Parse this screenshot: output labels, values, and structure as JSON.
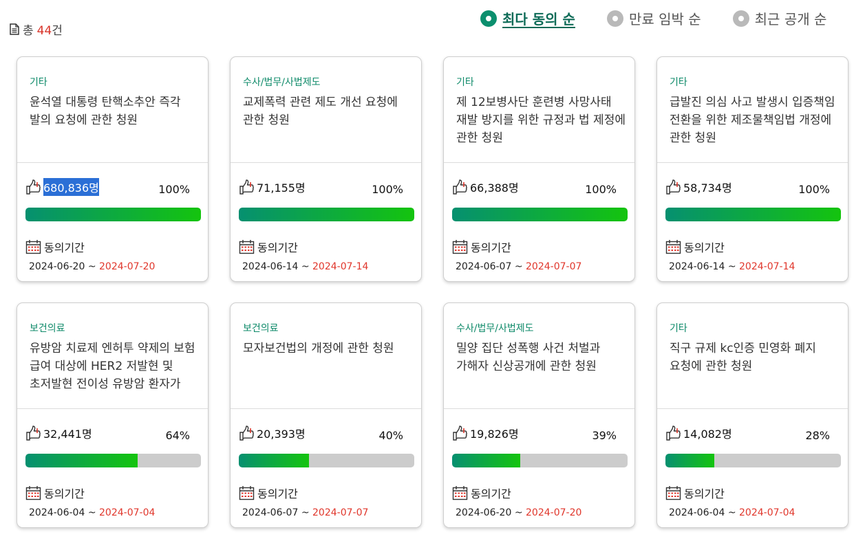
{
  "header": {
    "total_prefix": "총",
    "total_count": "44",
    "total_suffix": "건"
  },
  "sort": {
    "options": [
      {
        "label": "최다 동의 순",
        "selected": true
      },
      {
        "label": "만료 임박 순",
        "selected": false
      },
      {
        "label": "최근 공개 순",
        "selected": false
      }
    ]
  },
  "period_label": "동의기간",
  "date_separator": "~",
  "colors": {
    "accent": "#0c8f6e",
    "bar_start": "#069070",
    "bar_end": "#14c40e",
    "end_date": "#e0362b"
  },
  "icons": {
    "total": "document-icon",
    "likes": "thumbs-up-icon",
    "period": "calendar-icon"
  },
  "petitions": [
    {
      "category": "기타",
      "title": "윤석열 대통령 탄핵소추안 즉각 발의 요청에 관한 청원",
      "likes": "680,836명",
      "percent": "100%",
      "progress": 1.0,
      "start": "2024-06-20",
      "end": "2024-07-20",
      "likes_selected": true
    },
    {
      "category": "수사/법무/사법제도",
      "title": "교제폭력 관련 제도 개선 요청에 관한 청원",
      "likes": "71,155명",
      "percent": "100%",
      "progress": 1.0,
      "start": "2024-06-14",
      "end": "2024-07-14"
    },
    {
      "category": "기타",
      "title": "제 12보병사단 훈련병 사망사태 재발 방지를 위한 규정과 법 제정에 관한 청원",
      "likes": "66,388명",
      "percent": "100%",
      "progress": 1.0,
      "start": "2024-06-07",
      "end": "2024-07-07"
    },
    {
      "category": "기타",
      "title": "급발진 의심 사고 발생시 입증책임 전환을 위한 제조물책임법 개정에 관한 청원",
      "likes": "58,734명",
      "percent": "100%",
      "progress": 1.0,
      "start": "2024-06-14",
      "end": "2024-07-14"
    },
    {
      "category": "보건의료",
      "title": "유방암 치료제 엔허투 약제의 보험 급여 대상에 HER2 저발현 및 초저발현 전이성 유방암 환자가 포함될 수 있도록 요청에 관한 청원",
      "likes": "32,441명",
      "percent": "64%",
      "progress": 0.64,
      "start": "2024-06-04",
      "end": "2024-07-04"
    },
    {
      "category": "보건의료",
      "title": "모자보건법의 개정에 관한 청원",
      "likes": "20,393명",
      "percent": "40%",
      "progress": 0.4,
      "start": "2024-06-07",
      "end": "2024-07-07"
    },
    {
      "category": "수사/법무/사법제도",
      "title": "밀양 집단 성폭행 사건 처벌과 가해자 신상공개에 관한 청원",
      "likes": "19,826명",
      "percent": "39%",
      "progress": 0.39,
      "start": "2024-06-20",
      "end": "2024-07-20"
    },
    {
      "category": "기타",
      "title": "직구 규제 kc인증 민영화 폐지 요청에 관한 청원",
      "likes": "14,082명",
      "percent": "28%",
      "progress": 0.28,
      "start": "2024-06-04",
      "end": "2024-07-04"
    }
  ]
}
